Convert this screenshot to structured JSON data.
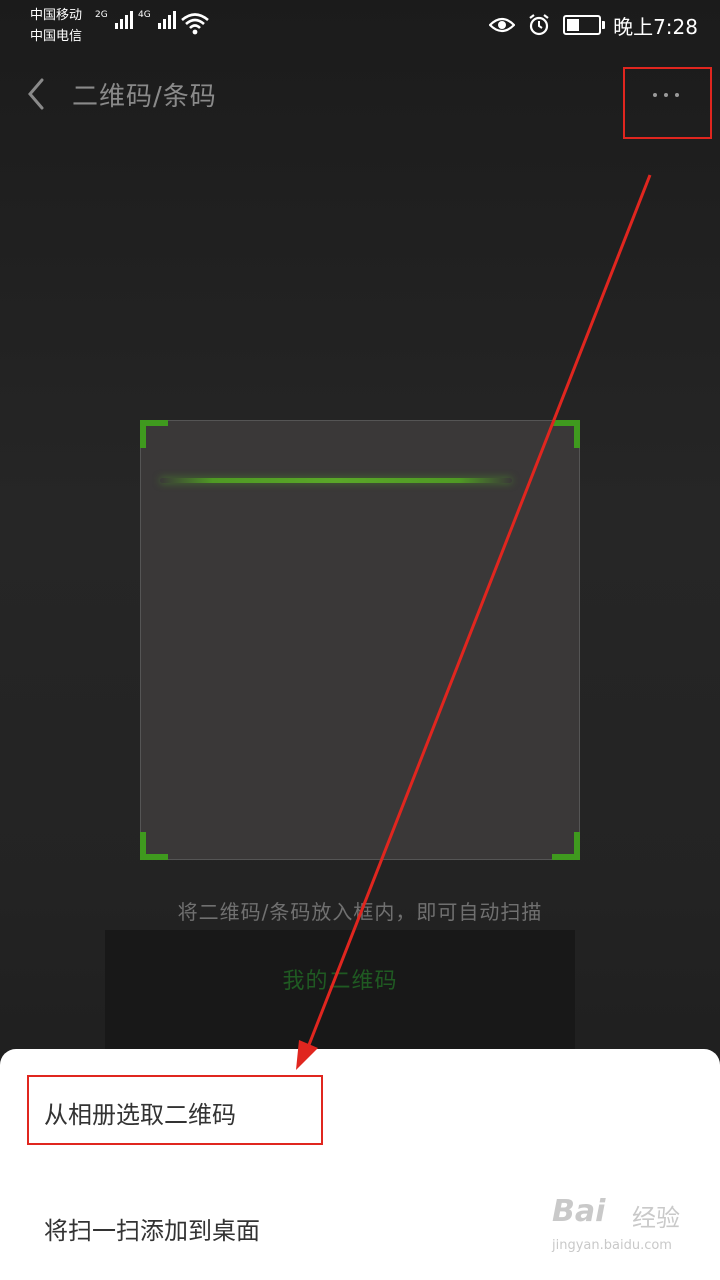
{
  "status_bar": {
    "carrier_1": "中国移动",
    "carrier_2": "中国电信",
    "net_1": "2G",
    "net_2": "4G",
    "time": "晚上7:28",
    "icons": [
      "eye-icon",
      "alarm-icon",
      "battery-icon",
      "wifi-icon"
    ]
  },
  "header": {
    "title": "二维码/条码"
  },
  "scanner": {
    "hint": "将二维码/条码放入框内，即可自动扫描",
    "my_qr_label": "我的二维码"
  },
  "bottom_sheet": {
    "items": [
      {
        "label": "从相册选取二维码"
      },
      {
        "label": "将扫一扫添加到桌面"
      }
    ]
  },
  "watermark": {
    "logo": "Bai",
    "text": "经验",
    "url": "jingyan.baidu.com"
  },
  "colors": {
    "highlight": "#e0261f",
    "scan_green": "#3f9a1e",
    "sheet_bg": "#ffffff"
  }
}
